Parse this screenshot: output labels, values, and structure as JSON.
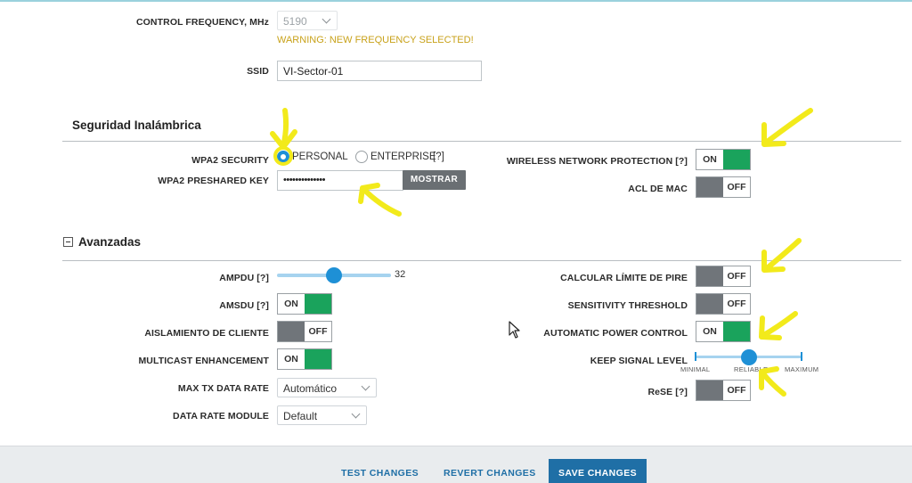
{
  "control_frequency": {
    "label": "CONTROL FREQUENCY, MHz",
    "value": "5190",
    "warning": "WARNING: NEW FREQUENCY SELECTED!"
  },
  "ssid": {
    "label": "SSID",
    "value": "VI-Sector-01"
  },
  "wireless_security": {
    "title": "Seguridad Inalámbrica",
    "wpa2_security": {
      "label": "WPA2 SECURITY",
      "options": [
        "PERSONAL",
        "ENTERPRISE"
      ],
      "selected": "PERSONAL",
      "help": "[?]"
    },
    "preshared_key": {
      "label": "WPA2 PRESHARED KEY",
      "value": "••••••••••••••",
      "button": "MOSTRAR"
    },
    "wireless_network_protection": {
      "label": "WIRELESS NETWORK PROTECTION [?]",
      "state": "ON"
    },
    "acl_mac": {
      "label": "ACL DE MAC",
      "state": "OFF"
    }
  },
  "advanced": {
    "title": "Avanzadas",
    "ampdu": {
      "label": "AMPDU [?]",
      "value": "32",
      "fraction": 0.5
    },
    "amsdu": {
      "label": "AMSDU [?]",
      "state": "ON"
    },
    "client_isolation": {
      "label": "AISLAMIENTO DE CLIENTE",
      "state": "OFF"
    },
    "multicast": {
      "label": "MULTICAST ENHANCEMENT",
      "state": "ON"
    },
    "max_tx_rate": {
      "label": "MAX TX DATA RATE",
      "value": "Automático"
    },
    "data_rate_module": {
      "label": "DATA RATE MODULE",
      "value": "Default"
    },
    "pire_limit": {
      "label": "CALCULAR LÍMITE DE PIRE",
      "state": "OFF"
    },
    "sensitivity": {
      "label": "SENSITIVITY THRESHOLD",
      "state": "OFF"
    },
    "auto_power": {
      "label": "AUTOMATIC POWER CONTROL",
      "state": "ON"
    },
    "keep_signal": {
      "label": "KEEP SIGNAL LEVEL",
      "scale": [
        "MINIMAL",
        "RELIABLE",
        "MAXIMUM"
      ],
      "selected": "RELIABLE"
    },
    "rese": {
      "label": "ReSE [?]",
      "state": "OFF"
    }
  },
  "footer": {
    "test": "TEST CHANGES",
    "revert": "REVERT CHANGES",
    "save": "SAVE CHANGES"
  },
  "colors": {
    "accent": "#1e90d6",
    "toggle_on": "#1aa35c",
    "toggle_off": "#70757a",
    "warning": "#c8a21a",
    "annotation": "#f2ea1b"
  }
}
